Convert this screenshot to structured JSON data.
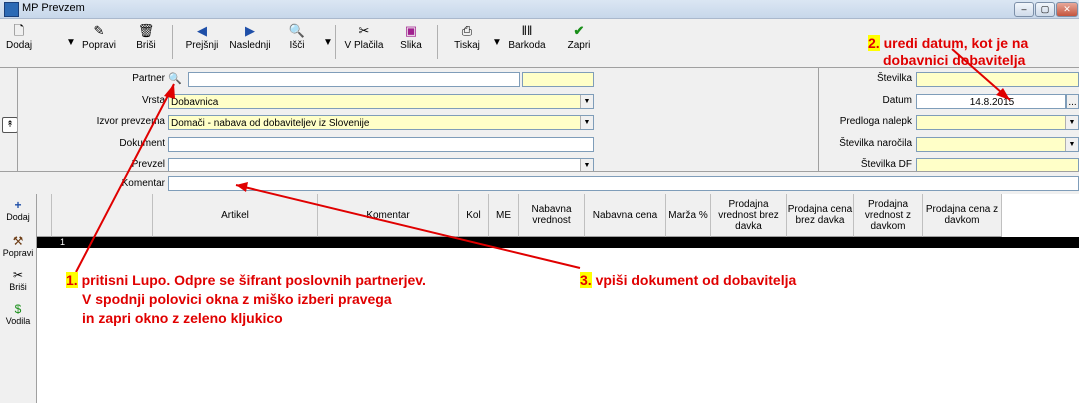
{
  "window": {
    "title": "MP Prevzem",
    "controls": [
      "–",
      "▢",
      "✕"
    ]
  },
  "toolbar": {
    "buttons": [
      {
        "name": "dodaj",
        "label": "Dodaj",
        "icon": "🗋"
      },
      {
        "name": "popravi",
        "label": "Popravi",
        "icon": "✎"
      },
      {
        "name": "brisi",
        "label": "Briši",
        "icon": "🗑"
      },
      {
        "name": "prejsnji",
        "label": "Prejšnji",
        "icon": "◀"
      },
      {
        "name": "naslednji",
        "label": "Naslednji",
        "icon": "▶"
      },
      {
        "name": "isci",
        "label": "Išči",
        "icon": "🔍"
      },
      {
        "name": "v-placila",
        "label": "V Plačila",
        "icon": "✂"
      },
      {
        "name": "slika",
        "label": "Slika",
        "icon": "▣"
      },
      {
        "name": "tiskaj",
        "label": "Tiskaj",
        "icon": "⎙"
      },
      {
        "name": "barkoda",
        "label": "Barkoda",
        "icon": "‖‖"
      },
      {
        "name": "zapri",
        "label": "Zapri",
        "icon": "✔"
      }
    ]
  },
  "form": {
    "partner": {
      "label": "Partner",
      "value": "",
      "code": ""
    },
    "vrsta": {
      "label": "Vrsta",
      "value": "Dobavnica"
    },
    "izvor": {
      "label": "Izvor prevzema",
      "value": "Domači - nabava od dobaviteljev iz Slovenije"
    },
    "dokument": {
      "label": "Dokument",
      "value": ""
    },
    "prevzel": {
      "label": "Prevzel",
      "value": ""
    },
    "stevilka": {
      "label": "Številka",
      "value": ""
    },
    "datum": {
      "label": "Datum",
      "value": "14.8.2015",
      "button": "..."
    },
    "predloga": {
      "label": "Predloga nalepk",
      "value": ""
    },
    "narocilo": {
      "label": "Številka naročila",
      "value": ""
    },
    "df": {
      "label": "Številka DF",
      "value": ""
    },
    "komentar": {
      "label": "Komentar",
      "value": ""
    }
  },
  "left_actions": [
    {
      "name": "dodaj",
      "label": "Dodaj",
      "icon": "+"
    },
    {
      "name": "popravi",
      "label": "Popravi",
      "icon": "⚒"
    },
    {
      "name": "brisi",
      "label": "Briši",
      "icon": "✂"
    },
    {
      "name": "vodila",
      "label": "Vodila",
      "icon": "$"
    }
  ],
  "grid": {
    "columns": [
      "Artikel",
      "Komentar",
      "Kol",
      "ME",
      "Nabavna vrednost",
      "Nabavna cena",
      "Marža %",
      "Prodajna vrednost brez davka",
      "Prodajna cena brez davka",
      "Prodajna vrednost z davkom",
      "Prodajna cena z davkom"
    ],
    "rows": [
      {
        "num": "1"
      }
    ]
  },
  "annotations": {
    "a1_num": "1.",
    "a1_line1": "pritisni Lupo. Odpre se šifrant poslovnih partnerjev.",
    "a1_line2": "V spodnji polovici okna z miško izberi pravega",
    "a1_line3": "in zapri okno z zeleno kljukico",
    "a2_num": "2.",
    "a2_line1": "uredi datum, kot je na",
    "a2_line2": "dobavnici dobavitelja",
    "a3_num": "3.",
    "a3_text": "vpiši dokument od dobavitelja"
  },
  "colors": {
    "annotation": "#e00000",
    "highlight": "#ffff00",
    "field_yellow": "#ffffc8"
  }
}
